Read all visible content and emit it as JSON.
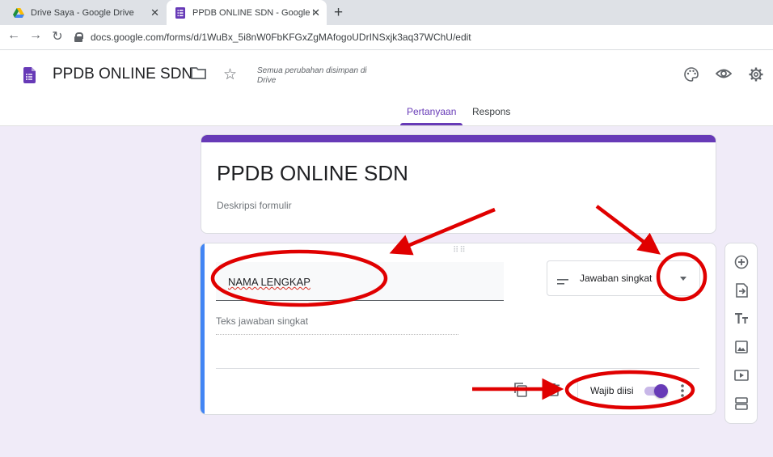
{
  "browser": {
    "tabs": [
      {
        "title": "Drive Saya - Google Drive",
        "active": false
      },
      {
        "title": "PPDB ONLINE SDN - Google For",
        "active": true
      }
    ],
    "url": "docs.google.com/forms/d/1WuBx_5i8nW0FbKFGxZgMAfogoUDrINSxjk3aq37WChU/edit"
  },
  "header": {
    "title": "PPDB ONLINE SDN",
    "save_status": "Semua perubahan disimpan di Drive",
    "tabs": [
      {
        "label": "Pertanyaan",
        "active": true
      },
      {
        "label": "Respons",
        "active": false
      }
    ]
  },
  "form": {
    "title": "PPDB ONLINE SDN",
    "description_placeholder": "Deskripsi formulir"
  },
  "question": {
    "title": "NAMA LENGKAP",
    "type": "Jawaban singkat",
    "answer_placeholder": "Teks jawaban singkat",
    "required_label": "Wajib diisi",
    "required": true
  },
  "colors": {
    "accent": "#673ab7",
    "focus_bar": "#4285f4",
    "background": "#f0ebf8",
    "annotation": "#e00000"
  },
  "icons": [
    "drive-icon",
    "forms-icon",
    "back-icon",
    "forward-icon",
    "reload-icon",
    "lock-icon",
    "folder-icon",
    "star-icon",
    "palette-icon",
    "preview-icon",
    "settings-icon",
    "copy-icon",
    "delete-icon",
    "more-vert-icon",
    "add-question-icon",
    "import-questions-icon",
    "add-title-icon",
    "add-image-icon",
    "add-video-icon",
    "add-section-icon"
  ]
}
